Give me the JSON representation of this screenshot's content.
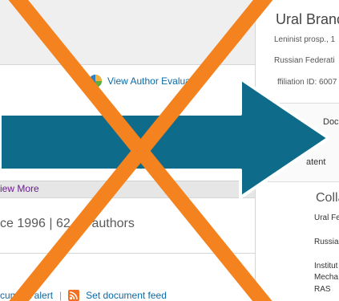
{
  "left": {
    "view_author_evaluator": "View Author Evaluator",
    "view_more": "iew More",
    "author_stats": "ce 1996 | 62 co-authors",
    "document_alert": "cument alert",
    "set_document_feed": "Set document feed",
    "separator": "|"
  },
  "right": {
    "institution": "Ural Branch,",
    "address_line1": "Leninist prosp., 1",
    "address_line2": "Russian Federati",
    "affiliation_id": "ffiliation ID: 6007",
    "tab_documents": "Doc",
    "tab_patents": "atent",
    "collaborations_title": "Colla",
    "collab_items": [
      "Ural Fe",
      "Russia",
      "Institut",
      "Mecha",
      "RAS"
    ]
  },
  "colors": {
    "arrow": "#0e6b8a",
    "cross": "#f4821f",
    "link": "#0a6aa8",
    "visited": "#6b1c8f"
  },
  "icons": {
    "evaluator": "pie-chart-icon",
    "feed": "rss-icon",
    "overlay_arrow": "right-arrow-icon",
    "overlay_cross": "x-mark-icon"
  }
}
